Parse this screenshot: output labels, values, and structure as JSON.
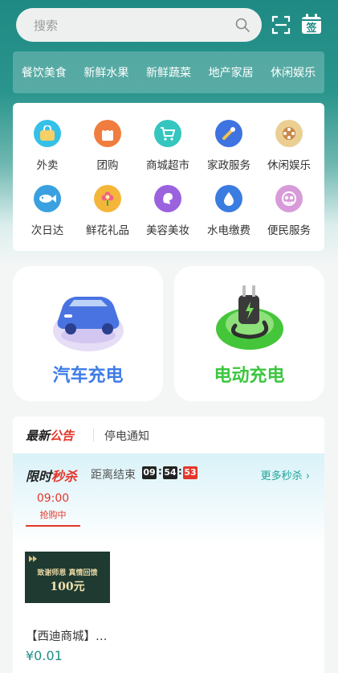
{
  "search": {
    "placeholder": "搜索"
  },
  "categories": [
    "餐饮美食",
    "新鲜水果",
    "新鲜蔬菜",
    "地产家居",
    "休闲娱乐"
  ],
  "services": [
    {
      "label": "外卖",
      "icon": "takeout-bag-icon",
      "color": "#e8c06a"
    },
    {
      "label": "团购",
      "icon": "shopping-bag-icon",
      "color": "#f08a4b"
    },
    {
      "label": "商城超市",
      "icon": "shopping-cart-icon",
      "color": "#3cc7c1"
    },
    {
      "label": "家政服务",
      "icon": "cleaning-brush-icon",
      "color": "#4b7de0"
    },
    {
      "label": "休闲娱乐",
      "icon": "film-reel-icon",
      "color": "#e0b870"
    },
    {
      "label": "次日达",
      "icon": "fish-icon",
      "color": "#3aa3e0"
    },
    {
      "label": "鲜花礼品",
      "icon": "flower-icon",
      "color": "#f1b339"
    },
    {
      "label": "美容美妆",
      "icon": "beauty-face-icon",
      "color": "#a06ae0"
    },
    {
      "label": "水电缴费",
      "icon": "water-drop-icon",
      "color": "#3c7fe0"
    },
    {
      "label": "便民服务",
      "icon": "community-service-icon",
      "color": "#d59ad6"
    }
  ],
  "charging": {
    "car": {
      "label": "汽车充电",
      "color": "#3f7ce8"
    },
    "electric": {
      "label": "电动充电",
      "color": "#3cc63f"
    }
  },
  "notice": {
    "brand_a": "最新",
    "brand_b": "公告",
    "text": "停电通知"
  },
  "flash_sale": {
    "title_a": "限时",
    "title_b": "秒杀",
    "ends_label": "距离结束",
    "countdown": [
      "09",
      "54",
      "53"
    ],
    "more_label": "更多秒杀",
    "slot": {
      "time": "09:00",
      "status": "抢购中"
    }
  },
  "product": {
    "image_text_1": "致谢师恩 真情回馈",
    "image_text_2": "100元",
    "name": "【西迪商城】…",
    "price": "¥0.01"
  },
  "colors": {
    "brand": "#1e8a83",
    "accent_red": "#e5352b",
    "price": "#1f8e86"
  }
}
